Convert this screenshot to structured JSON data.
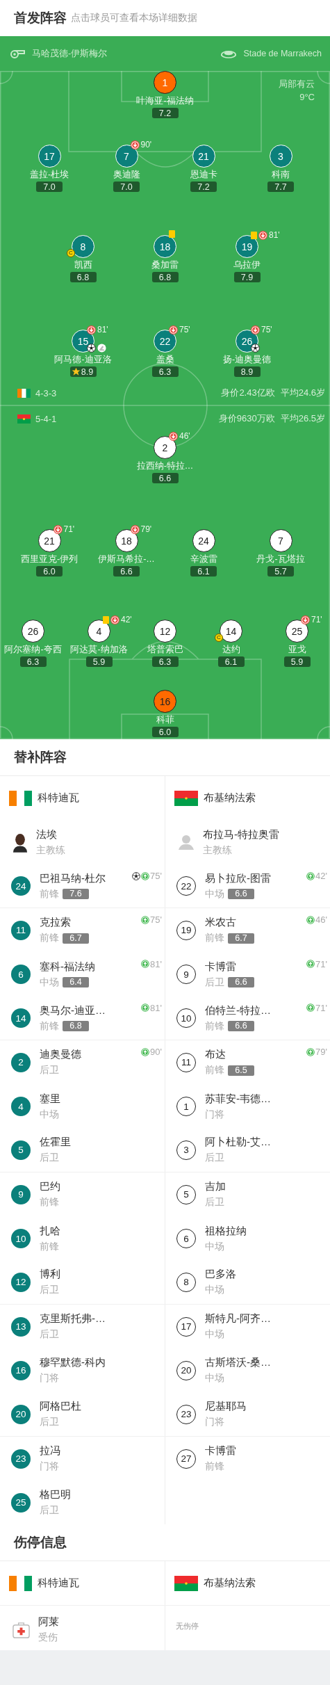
{
  "header": {
    "title": "首发阵容",
    "hint": "点击球员可查看本场详细数据"
  },
  "match": {
    "referee": "马哈茂德-伊斯梅尔",
    "venue": "Stade de Marrakech",
    "weather": "局部有云",
    "temperature": "9°C"
  },
  "home": {
    "goalkeeper": {
      "number": "1",
      "name": "叶海亚-福法纳",
      "rating": "7.2",
      "mvp": false
    },
    "lines": [
      [
        {
          "number": "17",
          "name": "盖拉-杜埃",
          "rating": "7.0",
          "mvp": false
        },
        {
          "number": "7",
          "name": "奥迪隆",
          "rating": "7.0",
          "mvp": false,
          "events": [
            {
              "kind": "sub_out",
              "minute": "90'"
            }
          ]
        },
        {
          "number": "21",
          "name": "恩迪卡",
          "rating": "7.2",
          "mvp": false
        },
        {
          "number": "3",
          "name": "科南",
          "rating": "7.7",
          "mvp": false
        }
      ],
      [
        {
          "number": "8",
          "name": "凯西",
          "rating": "6.8",
          "captain_mark": "C",
          "mvp": false
        },
        {
          "number": "18",
          "name": "桑加雷",
          "rating": "6.8",
          "mvp": false,
          "events": [
            {
              "kind": "yellow_card"
            }
          ]
        },
        {
          "number": "19",
          "name": "乌拉伊",
          "rating": "7.9",
          "mvp": false,
          "events": [
            {
              "kind": "yellow_card"
            },
            {
              "kind": "sub_out",
              "minute": "81'"
            }
          ]
        }
      ],
      [
        {
          "number": "15",
          "name": "阿马德-迪亚洛",
          "rating": "8.9",
          "mvp": true,
          "events": [
            {
              "kind": "sub_out",
              "minute": "81'"
            },
            {
              "kind": "goal"
            },
            {
              "kind": "assist"
            }
          ]
        },
        {
          "number": "22",
          "name": "盖桑",
          "rating": "6.3",
          "mvp": false,
          "events": [
            {
              "kind": "sub_out",
              "minute": "75'"
            }
          ]
        },
        {
          "number": "26",
          "name": "扬-迪奥曼德",
          "rating": "8.9",
          "mvp": false,
          "events": [
            {
              "kind": "sub_out",
              "minute": "75'"
            },
            {
              "kind": "goal"
            }
          ]
        }
      ]
    ]
  },
  "teams_info": [
    {
      "formation": "4-3-3",
      "value": "身价2.43亿欧",
      "avg_age": "平均24.6岁"
    },
    {
      "formation": "5-4-1",
      "value": "身价9630万欧",
      "avg_age": "平均26.5岁"
    }
  ],
  "away": {
    "lines": [
      [
        {
          "number": "2",
          "name": "拉西纳-特拉…",
          "rating": "6.6",
          "mvp": false,
          "events": [
            {
              "kind": "sub_out",
              "minute": "46'"
            }
          ]
        }
      ],
      [
        {
          "number": "21",
          "name": "西里亚克-伊列",
          "rating": "6.0",
          "mvp": false,
          "events": [
            {
              "kind": "sub_out",
              "minute": "71'"
            }
          ]
        },
        {
          "number": "18",
          "name": "伊斯马希拉-…",
          "rating": "6.6",
          "mvp": false,
          "events": [
            {
              "kind": "sub_out",
              "minute": "79'"
            }
          ]
        },
        {
          "number": "24",
          "name": "辛波雷",
          "rating": "6.1",
          "mvp": false
        },
        {
          "number": "7",
          "name": "丹戈-瓦塔拉",
          "rating": "5.7",
          "mvp": false
        }
      ],
      [
        {
          "number": "26",
          "name": "阿尔塞纳-夸西",
          "rating": "6.3",
          "mvp": false
        },
        {
          "number": "4",
          "name": "阿达莫-纳加洛",
          "rating": "5.9",
          "mvp": false,
          "events": [
            {
              "kind": "yellow_card"
            },
            {
              "kind": "sub_out",
              "minute": "42'"
            }
          ]
        },
        {
          "number": "12",
          "name": "塔普索巴",
          "rating": "6.3",
          "mvp": false
        },
        {
          "number": "14",
          "name": "达约",
          "rating": "6.1",
          "captain_mark": "C",
          "mvp": false
        },
        {
          "number": "25",
          "name": "亚戈",
          "rating": "5.9",
          "mvp": false,
          "events": [
            {
              "kind": "sub_out",
              "minute": "71'"
            }
          ]
        }
      ]
    ],
    "goalkeeper": {
      "number": "16",
      "name": "科菲",
      "rating": "6.0",
      "mvp": false
    }
  },
  "substitutes": {
    "title": "替补阵容",
    "teams": [
      {
        "name": "科特迪瓦",
        "coach": {
          "name": "法埃",
          "role": "主教练"
        },
        "players": [
          {
            "number": "24",
            "name": "巴祖马纳-杜尔",
            "position": "前锋",
            "rating": "7.6",
            "events": [
              {
                "kind": "goal"
              },
              {
                "kind": "sub_in",
                "minute": "75'"
              }
            ]
          },
          {
            "number": "11",
            "name": "克拉索",
            "position": "前锋",
            "rating": "6.7",
            "events": [
              {
                "kind": "sub_in",
                "minute": "75'"
              }
            ]
          },
          {
            "number": "6",
            "name": "塞科-福法纳",
            "position": "中场",
            "rating": "6.4",
            "events": [
              {
                "kind": "sub_in",
                "minute": "81'"
              }
            ]
          },
          {
            "number": "14",
            "name": "奥马尔-迪亚…",
            "position": "前锋",
            "rating": "6.8",
            "events": [
              {
                "kind": "sub_in",
                "minute": "81'"
              }
            ]
          },
          {
            "number": "2",
            "name": "迪奥曼德",
            "position": "后卫",
            "events": [
              {
                "kind": "sub_in",
                "minute": "90'"
              }
            ]
          },
          {
            "number": "4",
            "name": "塞里",
            "position": "中场"
          },
          {
            "number": "5",
            "name": "佐霍里",
            "position": "后卫"
          },
          {
            "number": "9",
            "name": "巴约",
            "position": "前锋"
          },
          {
            "number": "10",
            "name": "扎哈",
            "position": "前锋"
          },
          {
            "number": "12",
            "name": "博利",
            "position": "后卫"
          },
          {
            "number": "13",
            "name": "克里斯托弗-…",
            "position": "后卫"
          },
          {
            "number": "16",
            "name": "穆罕默德-科内",
            "position": "门将"
          },
          {
            "number": "20",
            "name": "阿格巴杜",
            "position": "后卫"
          },
          {
            "number": "23",
            "name": "拉冯",
            "position": "门将"
          },
          {
            "number": "25",
            "name": "格巴明",
            "position": "后卫"
          }
        ]
      },
      {
        "name": "布基纳法索",
        "coach": {
          "name": "布拉马-特拉奥雷",
          "role": "主教练"
        },
        "players": [
          {
            "number": "22",
            "name": "易卜拉欣-图雷",
            "position": "中场",
            "rating": "6.6",
            "events": [
              {
                "kind": "sub_in",
                "minute": "42'"
              }
            ]
          },
          {
            "number": "19",
            "name": "米农古",
            "position": "前锋",
            "rating": "6.7",
            "events": [
              {
                "kind": "sub_in",
                "minute": "46'"
              }
            ]
          },
          {
            "number": "9",
            "name": "卡博雷",
            "position": "后卫",
            "rating": "6.6",
            "events": [
              {
                "kind": "sub_in",
                "minute": "71'"
              }
            ]
          },
          {
            "number": "10",
            "name": "伯特兰-特拉…",
            "position": "前锋",
            "rating": "6.6",
            "events": [
              {
                "kind": "sub_in",
                "minute": "71'"
              }
            ]
          },
          {
            "number": "11",
            "name": "布达",
            "position": "前锋",
            "rating": "6.5",
            "events": [
              {
                "kind": "sub_in",
                "minute": "79'"
              }
            ]
          },
          {
            "number": "1",
            "name": "苏菲安-韦德…",
            "position": "门将"
          },
          {
            "number": "3",
            "name": "阿卜杜勒-艾…",
            "position": "后卫"
          },
          {
            "number": "5",
            "name": "吉加",
            "position": "后卫"
          },
          {
            "number": "6",
            "name": "祖格拉纳",
            "position": "中场"
          },
          {
            "number": "8",
            "name": "巴多洛",
            "position": "中场"
          },
          {
            "number": "17",
            "name": "斯特凡-阿齐…",
            "position": "中场"
          },
          {
            "number": "20",
            "name": "古斯塔沃-桑…",
            "position": "中场"
          },
          {
            "number": "23",
            "name": "尼基耶马",
            "position": "门将"
          },
          {
            "number": "27",
            "name": "卡博雷",
            "position": "前锋"
          }
        ]
      }
    ]
  },
  "injuries": {
    "title": "伤停信息",
    "teams": [
      {
        "name": "科特迪瓦",
        "players": [
          {
            "name": "阿莱",
            "status": "受伤"
          }
        ]
      },
      {
        "name": "布基纳法索",
        "empty_text": "无伤停"
      }
    ]
  }
}
